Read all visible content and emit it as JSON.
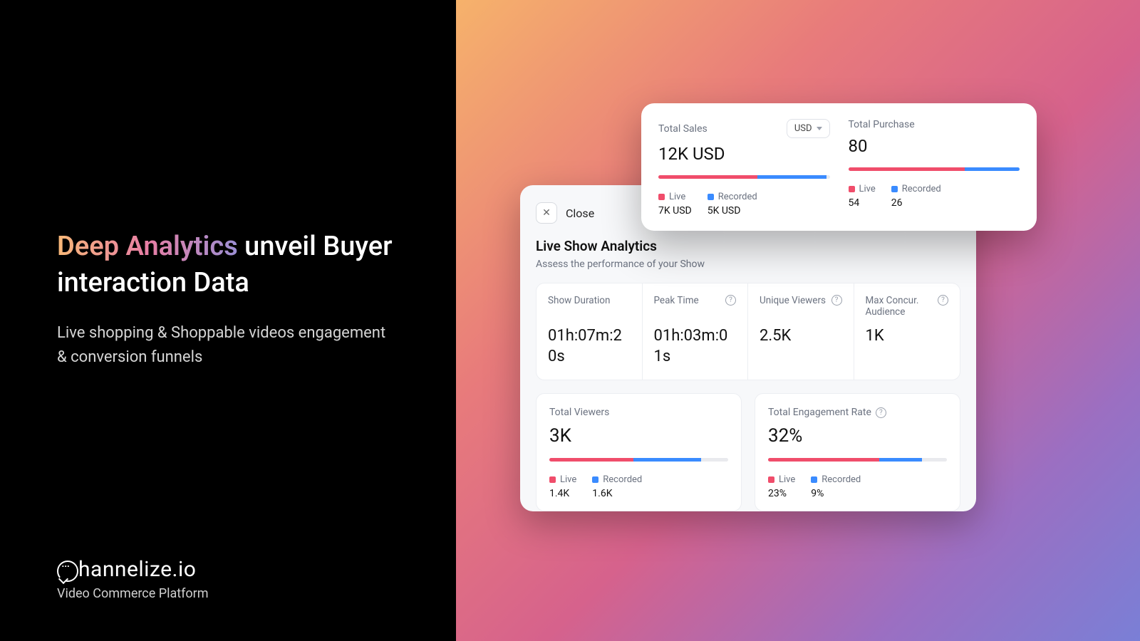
{
  "hero": {
    "headline_gradient": "Deep Analytics",
    "headline_rest": " unveil Buyer interaction Data",
    "sub": "Live shopping & Shoppable videos engagement & conversion funnels"
  },
  "brand": {
    "name": "hannelize.io",
    "tag": "Video Commerce Platform"
  },
  "close": {
    "label": "Close"
  },
  "analytics": {
    "title": "Live Show Analytics",
    "sub": "Assess the performance of your Show",
    "stats": {
      "duration_label": "Show Duration",
      "duration_value": "01h:07m:20s",
      "peak_label": "Peak Time",
      "peak_value": "01h:03m:01s",
      "unique_label": "Unique Viewers",
      "unique_value": "2.5K",
      "concur_label": "Max Concur. Audience",
      "concur_value": "1K"
    }
  },
  "viewers": {
    "label": "Total Viewers",
    "value": "3K",
    "live_pct": 47,
    "rec_pct": 38,
    "live_label": "Live",
    "rec_label": "Recorded",
    "live_val": "1.4K",
    "rec_val": "1.6K"
  },
  "engagement": {
    "label": "Total Engagement Rate",
    "value": "32%",
    "live_pct": 62,
    "rec_pct": 24,
    "live_label": "Live",
    "rec_label": "Recorded",
    "live_val": "23%",
    "rec_val": "9%"
  },
  "sales": {
    "label": "Total Sales",
    "currency": "USD",
    "value": "12K USD",
    "live_pct": 58,
    "rec_pct": 40,
    "live_label": "Live",
    "rec_label": "Recorded",
    "live_val": "7K USD",
    "rec_val": "5K USD"
  },
  "purchase": {
    "label": "Total Purchase",
    "value": "80",
    "live_pct": 68,
    "rec_pct": 32,
    "live_label": "Live",
    "rec_label": "Recorded",
    "live_val": "54",
    "rec_val": "26"
  }
}
